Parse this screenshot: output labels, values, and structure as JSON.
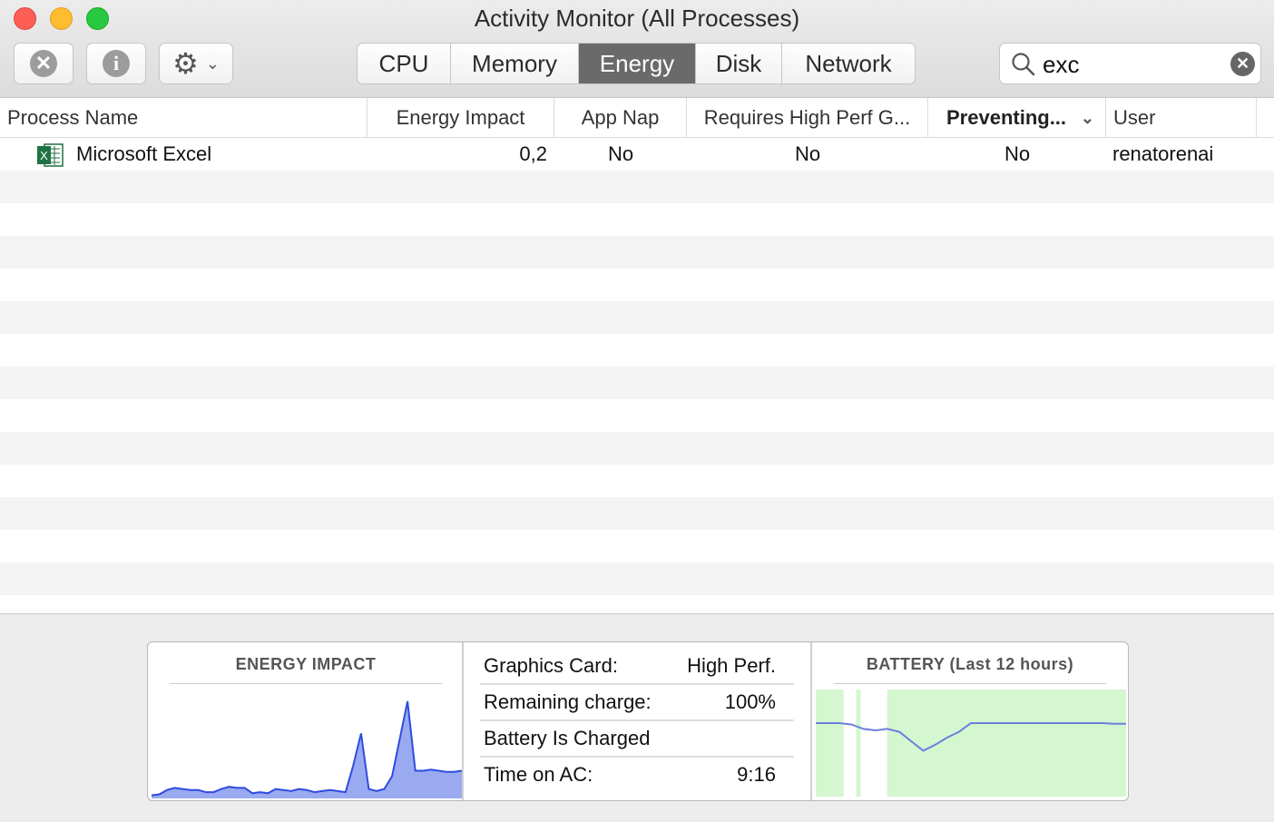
{
  "window": {
    "title": "Activity Monitor (All Processes)"
  },
  "toolbar": {
    "tabs": [
      "CPU",
      "Memory",
      "Energy",
      "Disk",
      "Network"
    ],
    "active_tab": "Energy",
    "search_value": "exc"
  },
  "table": {
    "columns": [
      "Process Name",
      "Energy Impact",
      "App Nap",
      "Requires High Perf G...",
      "Preventing...",
      "User"
    ],
    "sorted_column": "Preventing...",
    "rows": [
      {
        "process": "Microsoft Excel",
        "energy_impact": "0,2",
        "app_nap": "No",
        "requires_high_perf": "No",
        "preventing_sleep": "No",
        "user": "renatorenai"
      }
    ]
  },
  "summary": {
    "energy_title": "ENERGY IMPACT",
    "battery_title": "BATTERY (Last 12 hours)",
    "stats": [
      {
        "label": "Graphics Card:",
        "value": "High Perf."
      },
      {
        "label": "Remaining charge:",
        "value": "100%"
      },
      {
        "label": "Battery Is Charged",
        "value": ""
      },
      {
        "label": "Time on AC:",
        "value": "9:16"
      }
    ]
  },
  "chart_data": [
    {
      "type": "area",
      "title": "ENERGY IMPACT",
      "series": [
        {
          "values": [
            2,
            3,
            7,
            9,
            8,
            7,
            7,
            5,
            5,
            8,
            10,
            9,
            9,
            4,
            5,
            4,
            8,
            7,
            6,
            8,
            7,
            5,
            6,
            7,
            6,
            5,
            30,
            60,
            8,
            6,
            8,
            20,
            55,
            90,
            25,
            25,
            26,
            25,
            24,
            24,
            25
          ]
        }
      ],
      "color": "#2f4ce0",
      "fill": "#9aaaf0"
    },
    {
      "type": "area",
      "title": "BATTERY (Last 12 hours)",
      "series": [
        {
          "values": [
            100,
            100,
            100,
            98,
            92,
            90,
            92,
            88,
            75,
            62,
            70,
            80,
            88,
            100,
            100,
            100,
            100,
            100,
            100,
            100,
            100,
            100,
            100,
            100,
            100,
            99,
            99
          ]
        }
      ],
      "ylim": [
        0,
        100
      ],
      "color": "#6b7fe0",
      "fill": "#d4f7cf"
    }
  ]
}
